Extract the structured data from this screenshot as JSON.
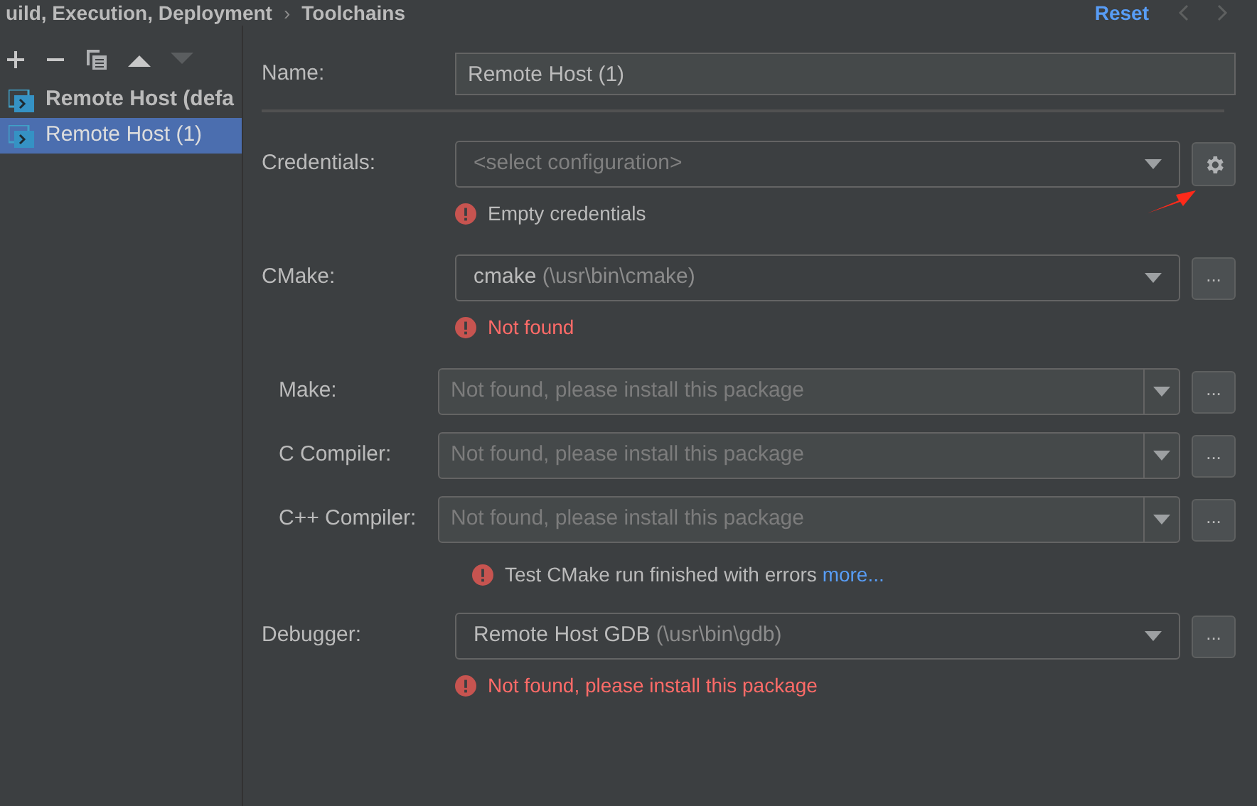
{
  "breadcrumb": {
    "path": "uild, Execution, Deployment",
    "separator": "›",
    "current": "Toolchains",
    "reset": "Reset"
  },
  "toolchains": [
    {
      "label": "Remote Host (defa",
      "bold": true,
      "selected": false
    },
    {
      "label": "Remote Host (1)",
      "bold": false,
      "selected": true
    }
  ],
  "name": {
    "label": "Name:",
    "value": "Remote Host (1)"
  },
  "rows": [
    {
      "kind": "combo",
      "label": "Credentials:",
      "placeholder": "<select configuration>",
      "button": {
        "kind": "gear"
      },
      "indent": false,
      "message": {
        "text": "Empty credentials",
        "kind": "warning"
      }
    },
    {
      "kind": "combo",
      "label": "CMake:",
      "value": "cmake",
      "hint": "(\\usr\\bin\\cmake)",
      "button": {
        "kind": "text",
        "label": "..."
      },
      "indent": false,
      "message": {
        "text": "Not found",
        "kind": "error"
      }
    },
    {
      "kind": "split",
      "label": "Make:",
      "placeholder": "Not found, please install this package",
      "button": {
        "kind": "text",
        "label": "..."
      },
      "indent": true
    },
    {
      "kind": "split",
      "label": "C Compiler:",
      "placeholder": "Not found, please install this package",
      "button": {
        "kind": "text",
        "label": "..."
      },
      "indent": true
    },
    {
      "kind": "split",
      "label": "C++ Compiler:",
      "placeholder": "Not found, please install this package",
      "button": {
        "kind": "text",
        "label": "..."
      },
      "indent": true,
      "message": {
        "text": "Test CMake run finished with errors",
        "link": "more...",
        "kind": "warning"
      }
    },
    {
      "kind": "combo",
      "label": "Debugger:",
      "value": "Remote Host GDB",
      "hint": "(\\usr\\bin\\gdb)",
      "button": {
        "kind": "text",
        "label": "..."
      },
      "indent": false,
      "message": {
        "text": "Not found, please install this package",
        "kind": "error"
      }
    }
  ]
}
